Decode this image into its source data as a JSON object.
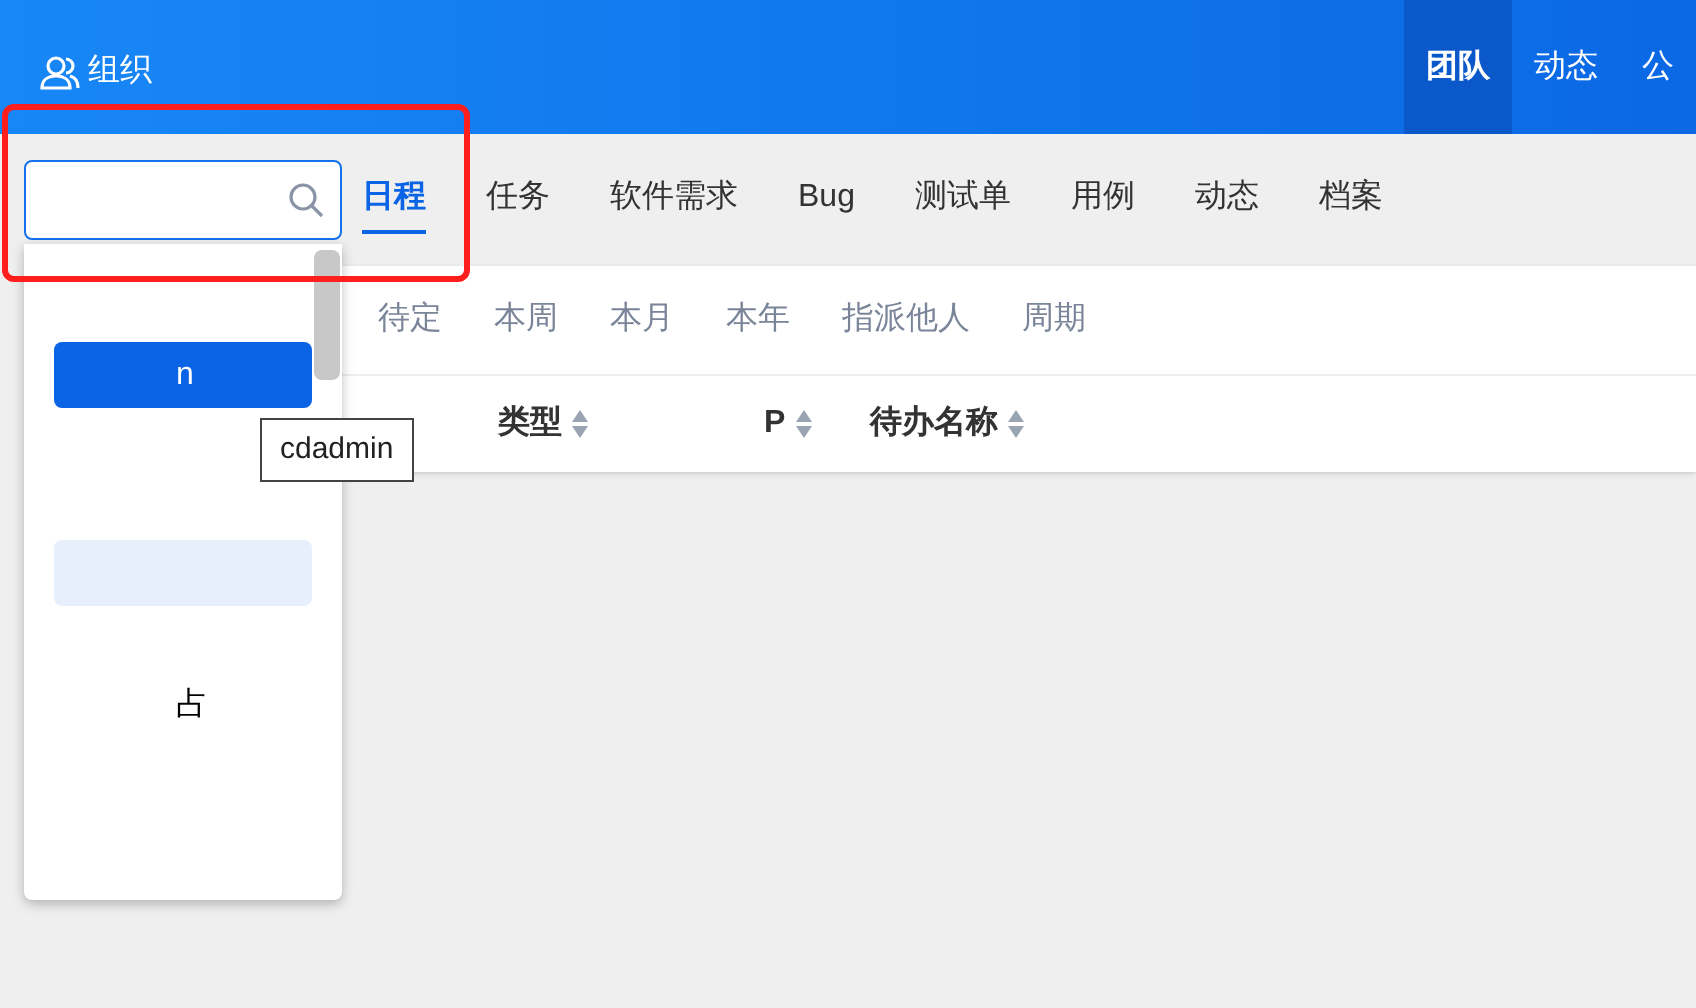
{
  "top_bar": {
    "org_label": "组织",
    "nav": [
      {
        "label": "团队",
        "selected": true
      },
      {
        "label": "动态",
        "selected": false
      },
      {
        "label": "公",
        "selected": false
      }
    ]
  },
  "search": {
    "kind": "search"
  },
  "tabs": [
    {
      "label": "日程",
      "selected": true
    },
    {
      "label": "任务",
      "selected": false
    },
    {
      "label": "软件需求",
      "selected": false
    },
    {
      "label": "Bug",
      "selected": false
    },
    {
      "label": "测试单",
      "selected": false
    },
    {
      "label": "用例",
      "selected": false
    },
    {
      "label": "动态",
      "selected": false
    },
    {
      "label": "档案",
      "selected": false
    }
  ],
  "filters": [
    {
      "label": "待定"
    },
    {
      "label": "本周"
    },
    {
      "label": "本月"
    },
    {
      "label": "本年"
    },
    {
      "label": "指派他人"
    },
    {
      "label": "周期"
    }
  ],
  "table": {
    "columns": [
      {
        "label": "类型"
      },
      {
        "label": "P"
      },
      {
        "label": "待办名称"
      }
    ]
  },
  "dropdown": {
    "items": [
      {
        "kind": "blank"
      },
      {
        "kind": "option",
        "text": "n",
        "selected": true,
        "hovered": false
      },
      {
        "kind": "blank"
      },
      {
        "kind": "blank"
      },
      {
        "kind": "option",
        "selected": false,
        "hovered": true
      },
      {
        "kind": "blank"
      },
      {
        "kind": "option",
        "text": "占",
        "selected": false,
        "hovered": false
      },
      {
        "kind": "blank"
      },
      {
        "kind": "blank"
      }
    ]
  },
  "tooltip": {
    "text": "cdadmin"
  }
}
